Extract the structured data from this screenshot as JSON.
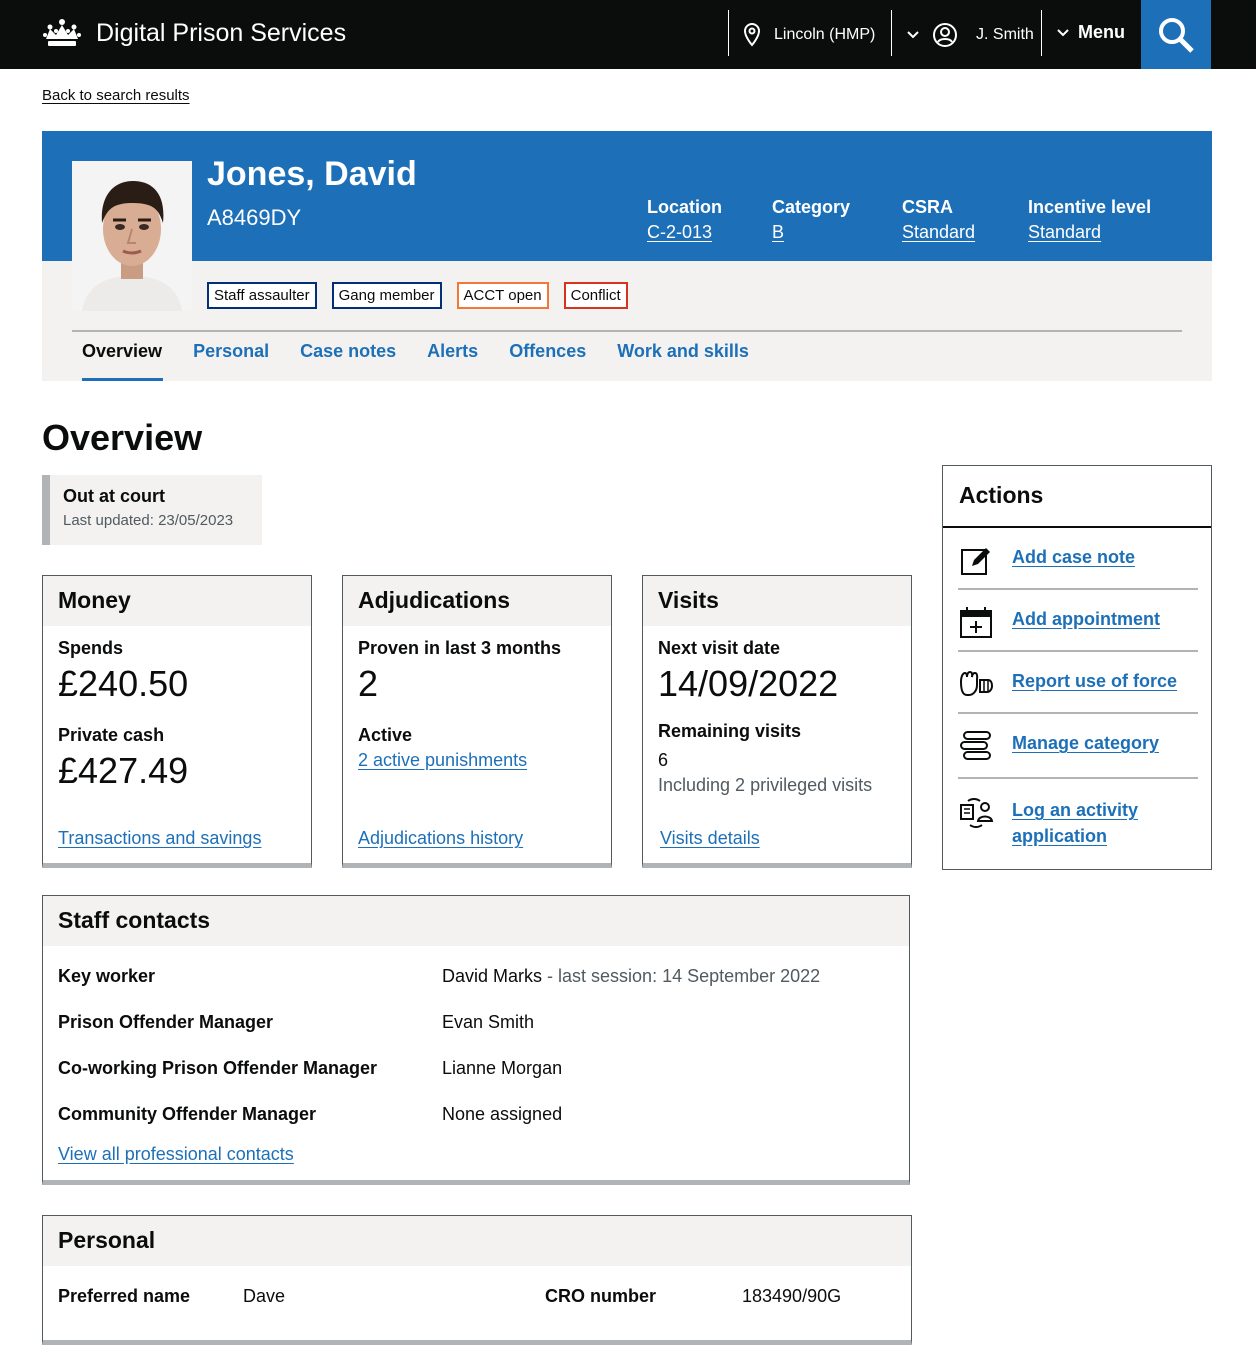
{
  "header": {
    "service": "Digital Prison Services",
    "location": "Lincoln (HMP)",
    "user": "J. Smith",
    "menu": "Menu"
  },
  "back_link": "Back to search results",
  "prisoner": {
    "name": "Jones, David",
    "number": "A8469DY",
    "meta": [
      {
        "key": "Location",
        "value": "C-2-013"
      },
      {
        "key": "Category",
        "value": "B"
      },
      {
        "key": "CSRA",
        "value": "Standard"
      },
      {
        "key": "Incentive level",
        "value": "Standard"
      }
    ],
    "flags": [
      "Staff assaulter",
      "Gang member",
      "ACCT open",
      "Conflict"
    ]
  },
  "tabs": [
    "Overview",
    "Personal",
    "Case notes",
    "Alerts",
    "Offences",
    "Work and skills"
  ],
  "page_title": "Overview",
  "status": {
    "title": "Out at court",
    "updated": "Last updated: 23/05/2023"
  },
  "money": {
    "title": "Money",
    "spends_label": "Spends",
    "spends": "£240.50",
    "private_label": "Private cash",
    "private": "£427.49",
    "link": "Transactions and savings"
  },
  "adjudications": {
    "title": "Adjudications",
    "proven_label": "Proven in last 3 months",
    "proven": "2",
    "active_label": "Active",
    "active_link": "2 active punishments",
    "link": "Adjudications history"
  },
  "visits": {
    "title": "Visits",
    "next_label": "Next visit date",
    "next": "14/09/2022",
    "remaining_label": "Remaining visits",
    "remaining": "6",
    "privileged": "Including 2 privileged visits",
    "link": "Visits details"
  },
  "actions": {
    "title": "Actions",
    "items": [
      "Add case note",
      "Add appointment",
      "Report use of force",
      "Manage category",
      "Log an activity application"
    ]
  },
  "staff": {
    "title": "Staff contacts",
    "rows": [
      {
        "key": "Key worker",
        "value": "David Marks",
        "extra": " - last session: 14 September 2022"
      },
      {
        "key": "Prison Offender Manager",
        "value": "Evan Smith"
      },
      {
        "key": "Co-working Prison Offender Manager",
        "value": "Lianne Morgan"
      },
      {
        "key": "Community Offender Manager",
        "value": "None assigned"
      }
    ],
    "link": "View all professional contacts"
  },
  "personal": {
    "title": "Personal",
    "preferred_label": "Preferred name",
    "preferred": "Dave",
    "cro_label": "CRO number",
    "cro": "183490/90G"
  }
}
